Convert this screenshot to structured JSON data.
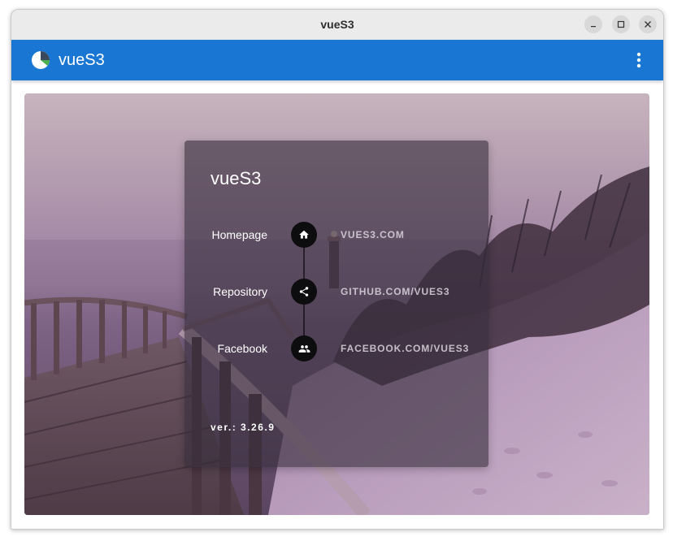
{
  "window": {
    "title": "vueS3",
    "controls": {
      "minimize_icon": "minimize-icon",
      "maximize_icon": "maximize-icon",
      "close_icon": "close-icon"
    }
  },
  "appbar": {
    "title": "vueS3",
    "logo_icon": "pie-chart-logo-icon",
    "menu_icon": "more-vert-icon",
    "color": "#1976d2"
  },
  "card": {
    "title": "vueS3",
    "links": [
      {
        "label": "Homepage",
        "icon": "home-icon",
        "text": "VUES3.COM"
      },
      {
        "label": "Repository",
        "icon": "share-icon",
        "text": "GITHUB.COM/VUES3"
      },
      {
        "label": "Facebook",
        "icon": "people-icon",
        "text": "FACEBOOK.COM/VUES3"
      }
    ],
    "version": "ver.: 3.26.9"
  }
}
